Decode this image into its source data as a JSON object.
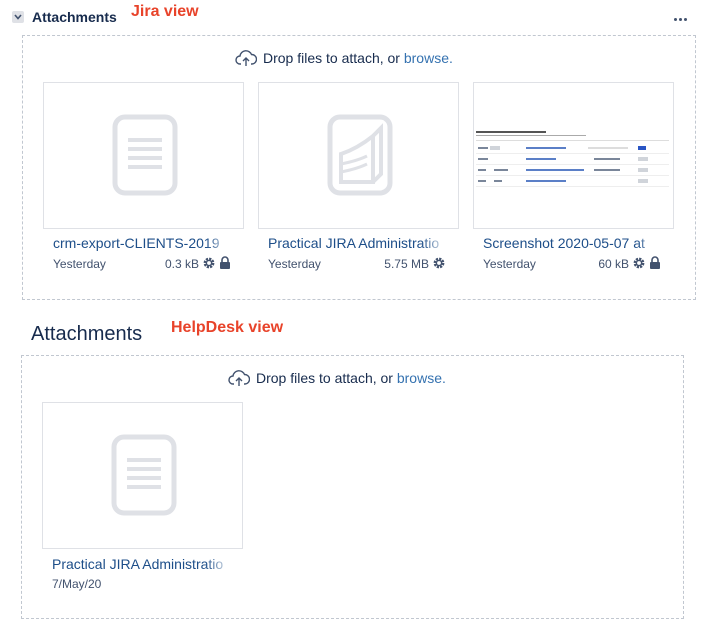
{
  "annotations": {
    "jira": "Jira view",
    "helpdesk": "HelpDesk view"
  },
  "jira": {
    "title": "Attachments",
    "dropzone": {
      "text": "Drop files to attach, or ",
      "browse": "browse."
    },
    "attachments": [
      {
        "name": "crm-export-CLIENTS-2019",
        "date": "Yesterday",
        "size": "0.3 kB",
        "icon": "document-icon",
        "settings": true,
        "locked": true
      },
      {
        "name": "Practical JIRA Administratio",
        "date": "Yesterday",
        "size": "5.75 MB",
        "icon": "pdf-icon",
        "settings": true,
        "locked": false
      },
      {
        "name": "Screenshot 2020-05-07 at",
        "date": "Yesterday",
        "size": "60 kB",
        "icon": "image-preview",
        "settings": true,
        "locked": true
      }
    ]
  },
  "helpdesk": {
    "title": "Attachments",
    "dropzone": {
      "text": "Drop files to attach, or ",
      "browse": "browse."
    },
    "attachments": [
      {
        "name": "Practical JIRA Administratio",
        "date": "7/May/20",
        "icon": "document-icon"
      }
    ]
  },
  "colors": {
    "accent": "#3572b0",
    "annotation": "#e8432a",
    "text": "#172b4d",
    "muted": "#42526e"
  }
}
